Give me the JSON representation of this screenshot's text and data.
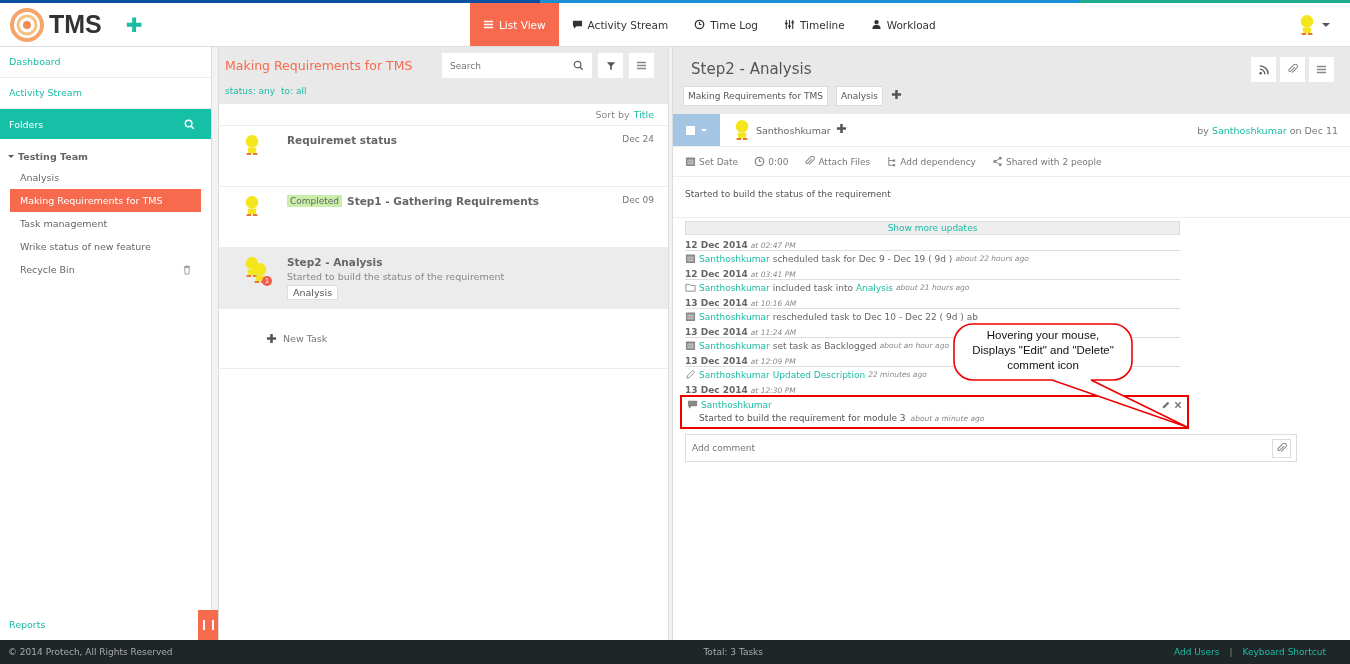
{
  "app": {
    "logo": "TMS",
    "add_label": "✚"
  },
  "nav_tabs": [
    {
      "label": "List View",
      "selected": true
    },
    {
      "label": "Activity Stream",
      "selected": false
    },
    {
      "label": "Time Log",
      "selected": false
    },
    {
      "label": "Timeline",
      "selected": false
    },
    {
      "label": "Workload",
      "selected": false
    }
  ],
  "sidebar": {
    "links": [
      "Dashboard",
      "Activity Stream"
    ],
    "folders_title": "Folders",
    "tree": [
      {
        "label": "Testing Team",
        "expanded": true,
        "selected": false,
        "children": [
          {
            "label": "Analysis",
            "kind": "folder",
            "selected": false
          },
          {
            "label": "Making Requirements for TMS",
            "kind": "folder",
            "selected": true
          },
          {
            "label": "Task management",
            "kind": "folder",
            "selected": false
          },
          {
            "label": "Wrike status of new feature",
            "kind": "folder",
            "selected": false
          },
          {
            "label": "Recycle Bin",
            "kind": "trash",
            "selected": false
          }
        ]
      }
    ],
    "bottom_link": "Reports"
  },
  "task_list": {
    "title": "Making Requirements for TMS",
    "search": {
      "placeholder": "Search"
    },
    "filters": [
      "status: any",
      "to: all"
    ],
    "sort_label": "Sort by",
    "sort_value": "Title",
    "tasks": [
      {
        "title": "Requiremet status",
        "date": "Dec 24",
        "selected": false
      },
      {
        "title": "Step1 - Gathering Requirements",
        "status": "Completed",
        "date": "Dec 09",
        "selected": false
      },
      {
        "title": "Step2 - Analysis",
        "description": "Started to build the status of the requirement",
        "tag": "Analysis",
        "badge": "1",
        "selected": true
      }
    ],
    "new_task": "New Task"
  },
  "detail": {
    "title": "Step2 - Analysis",
    "folders": [
      "Making Requirements for TMS",
      "Analysis"
    ],
    "assignee": "Santhoshkumar",
    "by_label": "by",
    "author": "Santhoshkumar",
    "on_label": "on Dec 11",
    "actions": [
      {
        "label": "Set Date"
      },
      {
        "label": "0:00"
      },
      {
        "label": "Attach Files"
      },
      {
        "label": "Add dependency"
      },
      {
        "label": "Shared with 2 people"
      }
    ],
    "description": "Started to build the status of the requirement",
    "show_more": "Show more updates",
    "updates": [
      {
        "date": "12 Dec 2014",
        "time": "at 02:47 PM",
        "kind": "schedule",
        "user": "Santhoshkumar",
        "text": "scheduled task for Dec 9 - Dec 19 ( 9d )",
        "ago": "about 22 hours ago"
      },
      {
        "date": "12 Dec 2014",
        "time": "at 03:41 PM",
        "kind": "folder",
        "user": "Santhoshkumar",
        "text": "included task into",
        "link": "Analysis",
        "ago": "about 21 hours ago"
      },
      {
        "date": "13 Dec 2014",
        "time": "at 10:16 AM",
        "kind": "schedule",
        "user": "Santhoshkumar",
        "text": "rescheduled task to Dec 10 - Dec 22 ( 9d ) ab"
      },
      {
        "date": "13 Dec 2014",
        "time": "at 11:24 AM",
        "kind": "schedule",
        "user": "Santhoshkumar",
        "text": "set task as Backlogged",
        "ago": "about an hour ago"
      },
      {
        "date": "13 Dec 2014",
        "time": "at 12:09 PM",
        "kind": "edit",
        "user": "Santhoshkumar",
        "link": "Updated Description",
        "ago": "22 minutes ago"
      }
    ],
    "comment": {
      "date": "13 Dec 2014",
      "time": "at 12:30 PM",
      "user": "Santhoshkumar",
      "text": "Started to build the requirement for module 3",
      "ago": "about a minute ago",
      "highlighted": true
    },
    "comment_field": {
      "placeholder": "Add comment"
    }
  },
  "callout": {
    "text": "Hovering your mouse, Displays \"Edit\" and \"Delete\" comment icon"
  },
  "footer": {
    "copyright": "© 2014 Protech, All Rights Reserved",
    "total": "Total: 3 Tasks",
    "links": [
      "Add Users",
      "Keyboard Shortcut"
    ],
    "separator": "|"
  }
}
